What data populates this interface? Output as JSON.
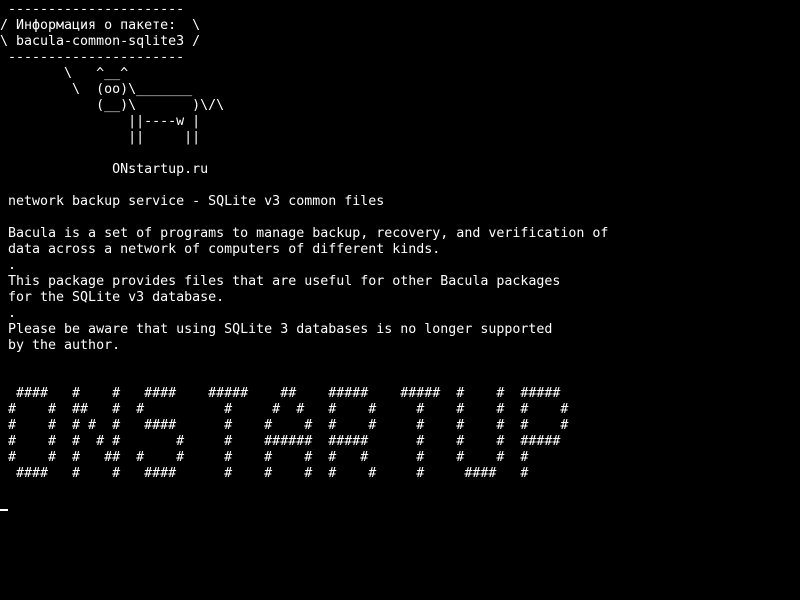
{
  "terminal": {
    "bubble": {
      "top": " ----------------------",
      "line1": "/ Информация о пакете:  \\",
      "line2": "\\ bacula-common-sqlite3 /",
      "bottom": " ----------------------"
    },
    "cow": [
      "        \\   ^__^",
      "         \\  (oo)\\_______",
      "            (__)\\       )\\/\\",
      "                ||----w |",
      "                ||     ||"
    ],
    "site": "              ONstartup.ru",
    "description": [
      " network backup service - SQLite v3 common files",
      " Bacula is a set of programs to manage backup, recovery, and verification of",
      " data across a network of computers of different kinds.",
      " .",
      " This package provides files that are useful for other Bacula packages",
      " for the SQLite v3 database.",
      " .",
      " Please be aware that using SQLite 3 databases is no longer supported",
      " by the author."
    ],
    "banner": [
      "  ####   #    #   ####    #####    ##    #####    #####  #    #  #####",
      " #    #  ##   #  #          #     #  #   #    #     #    #    #  #    #",
      " #    #  # #  #   ####      #    #    #  #    #     #    #    #  #    #",
      " #    #  #  # #       #     #    ######  #####      #    #    #  #####",
      " #    #  #   ##  #    #     #    #    #  #   #      #    #    #  #",
      "  ####   #    #   ####      #    #    #  #    #     #     ####   #"
    ]
  }
}
